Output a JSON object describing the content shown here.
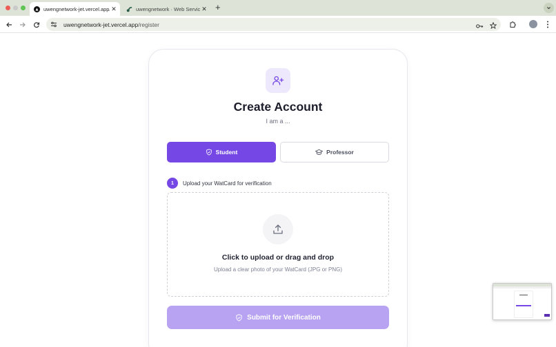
{
  "browser": {
    "tabs": [
      {
        "title": "uwengnetwork-jet.vercel.app/",
        "active": true,
        "favicon": "vercel-triangle-icon"
      },
      {
        "title": "uwengnetwork · Web Service",
        "active": false,
        "favicon": "render-logo-icon"
      }
    ],
    "url_host": "uwengnetwork-jet.vercel.app",
    "url_path": "/register"
  },
  "page": {
    "title": "Create Account",
    "subtitle": "I am a ...",
    "roles": {
      "student_label": "Student",
      "professor_label": "Professor"
    },
    "step": {
      "number": "1",
      "label": "Upload your WatCard for verification"
    },
    "upload": {
      "title": "Click to upload or drag and drop",
      "hint": "Upload a clear photo of your WatCard (JPG or PNG)"
    },
    "submit_label": "Submit for Verification"
  },
  "colors": {
    "accent": "#7548e6",
    "accent_disabled": "#b8a3f2",
    "accent_soft": "#ede8fb"
  }
}
